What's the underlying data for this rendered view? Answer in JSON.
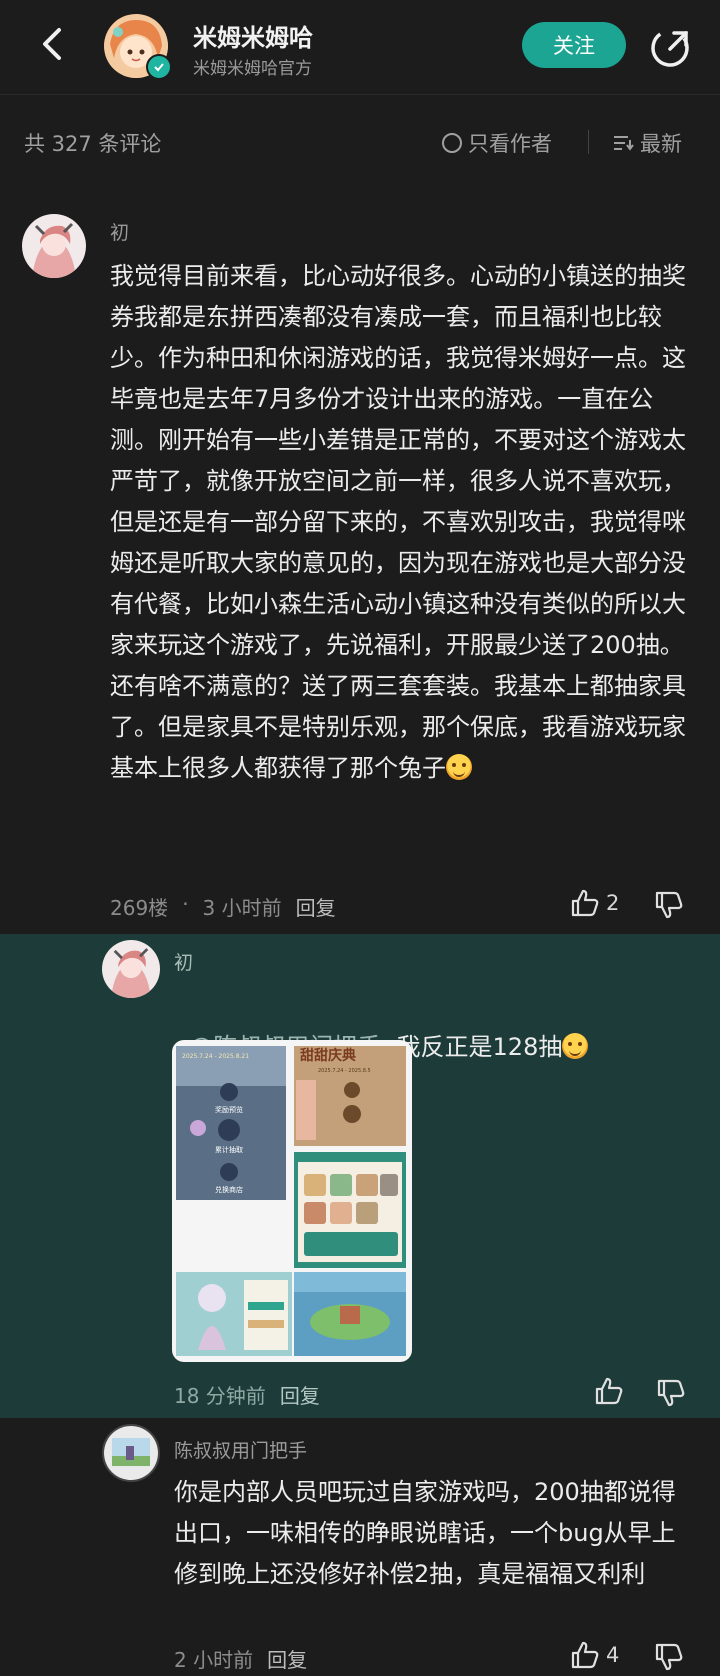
{
  "header": {
    "account_name": "米姆米姆哈",
    "account_sub": "米姆米姆哈官方",
    "follow_label": "关注"
  },
  "toolbar": {
    "count_label": "共 327 条评论",
    "only_author": "只看作者",
    "sort_label": "最新"
  },
  "comments": [
    {
      "name": "初",
      "text": "我觉得目前来看，比心动好很多。心动的小镇送的抽奖券我都是东拼西凑都没有凑成一套，而且福利也比较少。作为种田和休闲游戏的话，我觉得米姆好一点。这毕竟也是去年7月多份才设计出来的游戏。一直在公测。刚开始有一些小差错是正常的，不要对这个游戏太严苛了，就像开放空间之前一样，很多人说不喜欢玩，但是还是有一部分留下来的，不喜欢别攻击，我觉得咪姆还是听取大家的意见的，因为现在游戏也是大部分没有代餐，比如小森生活心动小镇这种没有类似的所以大家来玩这个游戏了，先说福利，开服最少送了200抽。还有啥不满意的？送了两三套套装。我基本上都抽家具了。但是家具不是特别乐观，那个保底，我看游戏玩家基本上很多人都获得了那个兔子",
      "floor": "269楼",
      "dot": "·",
      "time": "3 小时前",
      "reply_label": "回复",
      "likes": "2"
    }
  ],
  "replies": [
    {
      "name": "初",
      "mention": "@陈叔叔用门把手",
      "text": "我反正是128抽",
      "time": "18 分钟前",
      "reply_label": "回复"
    },
    {
      "name": "陈叔叔用门把手",
      "text": "你是内部人员吧玩过自家游戏吗，200抽都说得出口，一味相传的睁眼说瞎话，一个bug从早上修到晚上还没修好补偿2抽，真是福福又利利",
      "time": "2 小时前",
      "reply_label": "回复",
      "likes": "4"
    }
  ],
  "image_texts": {
    "t1": "2025.7.24 - 2025.8.21",
    "t2": "奖励预览",
    "t3": "累计抽取",
    "t4": "兑换商店",
    "t5": "甜甜庆典",
    "t6": "2025.7.24 - 2025.8.5"
  }
}
